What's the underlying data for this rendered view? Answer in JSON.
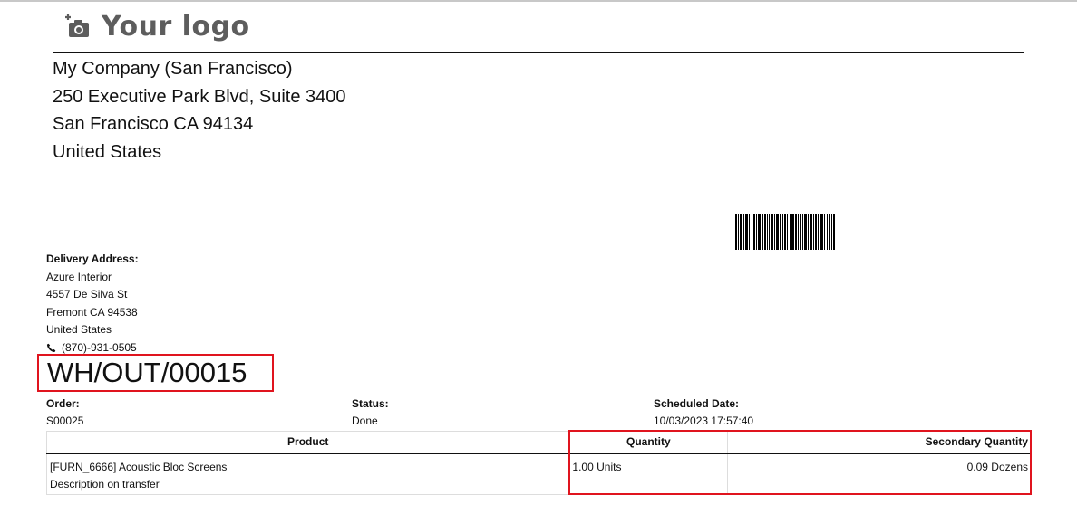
{
  "logo": {
    "text": "Your logo",
    "icon": "camera-plus-icon"
  },
  "company": {
    "name": "My Company (San Francisco)",
    "street": "250 Executive Park Blvd, Suite 3400",
    "city_line": "San Francisco CA 94134",
    "country": "United States"
  },
  "delivery": {
    "label": "Delivery Address:",
    "name": "Azure Interior",
    "street": "4557 De Silva St",
    "city_line": "Fremont CA 94538",
    "country": "United States",
    "phone": "(870)-931-0505",
    "phone_icon": "phone-icon"
  },
  "reference": "WH/OUT/00015",
  "meta": {
    "order_label": "Order:",
    "order_value": "S00025",
    "status_label": "Status:",
    "status_value": "Done",
    "scheduled_label": "Scheduled Date:",
    "scheduled_value": "10/03/2023 17:57:40"
  },
  "table": {
    "headers": [
      "Product",
      "Quantity",
      "Secondary Quantity"
    ],
    "rows": [
      {
        "product": "[FURN_6666] Acoustic Bloc Screens",
        "description": "Description on transfer",
        "quantity": "1.00 Units",
        "secondary_quantity": "0.09 Dozens"
      }
    ]
  },
  "colors": {
    "highlight": "#e0141e",
    "logo_text": "#5d5d5d"
  }
}
